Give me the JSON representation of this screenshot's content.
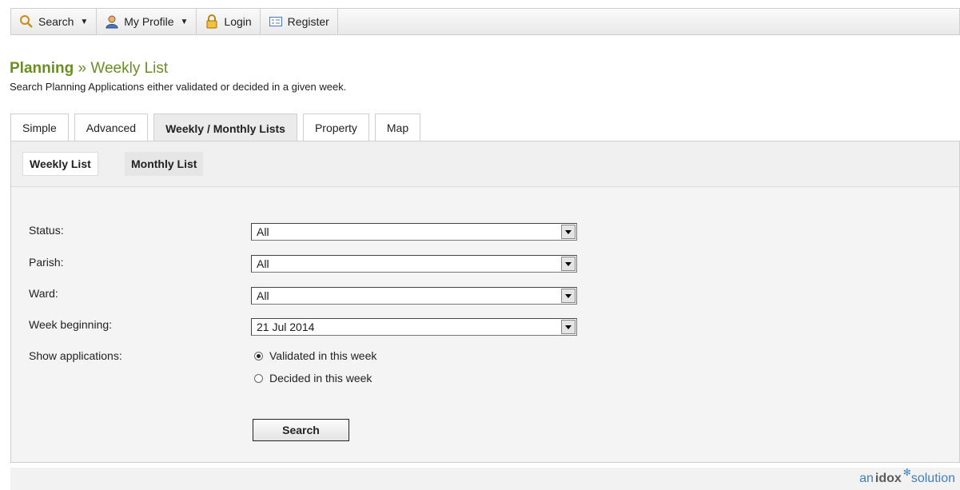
{
  "toolbar": {
    "search": "Search",
    "profile": "My Profile",
    "login": "Login",
    "register": "Register"
  },
  "heading": {
    "section": "Planning",
    "separator": "»",
    "page": "Weekly List",
    "subtitle": "Search Planning Applications either validated or decided in a given week."
  },
  "tabs": [
    "Simple",
    "Advanced",
    "Weekly / Monthly Lists",
    "Property",
    "Map"
  ],
  "subtabs": [
    "Weekly List",
    "Monthly List"
  ],
  "form": {
    "status_label": "Status:",
    "status_value": "All",
    "parish_label": "Parish:",
    "parish_value": "All",
    "ward_label": "Ward:",
    "ward_value": "All",
    "week_label": "Week beginning:",
    "week_value": "21 Jul 2014",
    "show_label": "Show applications:",
    "option_validated": "Validated in this week",
    "option_decided": "Decided in this week",
    "selected_option": "validated",
    "search_button": "Search"
  },
  "branding": {
    "prefix": "an",
    "name": "idox",
    "suffix": "solution",
    "color": "#3f7fc0"
  },
  "colors": {
    "title_green": "#6b8e23"
  }
}
